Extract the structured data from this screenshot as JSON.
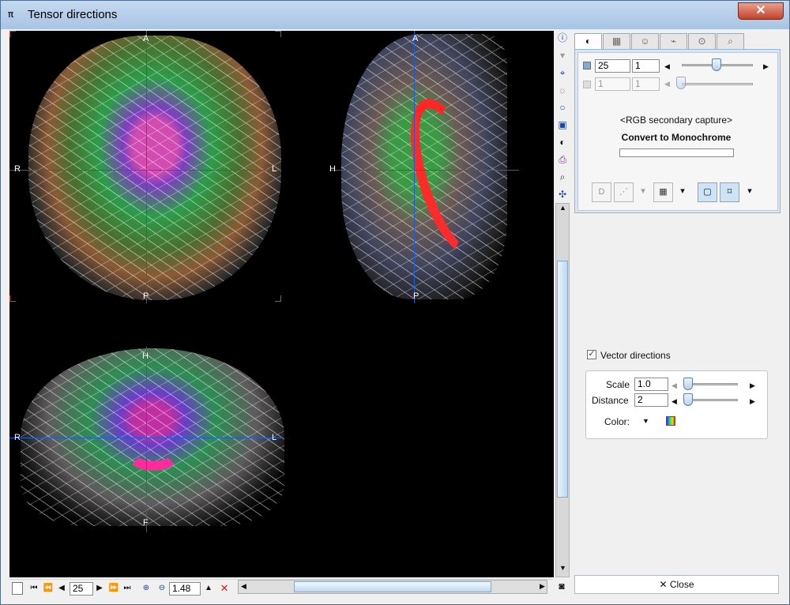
{
  "window": {
    "title": "Tensor directions",
    "close_symbol": "✕"
  },
  "viewer": {
    "orientation_labels": {
      "axial_anterior": "A",
      "axial_posterior": "P",
      "axial_right": "R",
      "axial_left": "L",
      "sagittal_anterior": "A",
      "sagittal_posterior": "P",
      "sagittal_head": "H",
      "coronal_head": "H",
      "coronal_foot": "F",
      "coronal_right": "R",
      "coronal_left": "L"
    }
  },
  "controls": {
    "slice_value": "25",
    "slice_step": "1",
    "secondary_slice_value": "1",
    "secondary_step": "1",
    "capture_label": "<RGB secondary capture>",
    "convert_label": "Convert to Monochrome",
    "progress_fill": 0
  },
  "vector_settings": {
    "checkbox_label": "Vector directions",
    "checked_symbol": "✓",
    "scale_label": "Scale",
    "scale_value": "1.0",
    "distance_label": "Distance",
    "distance_value": "2",
    "color_label": "Color:"
  },
  "bottom": {
    "slice_value": "25",
    "zoom_value": "1.48",
    "close_label": "Close"
  }
}
